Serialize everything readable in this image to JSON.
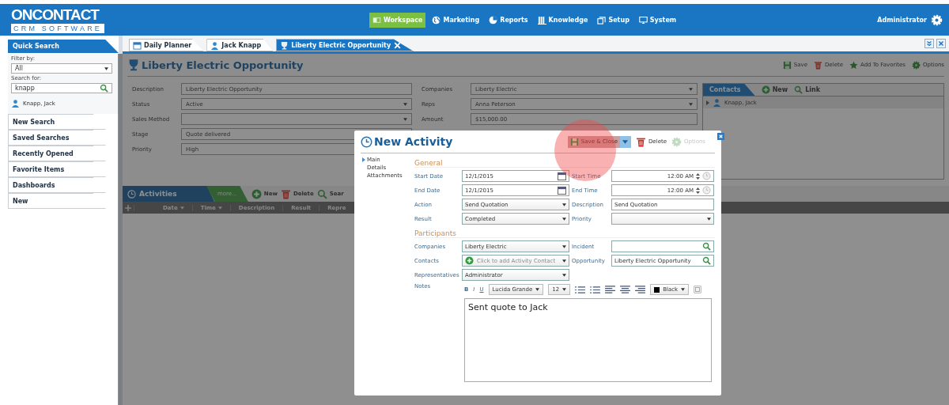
{
  "header": {
    "logo": "ONCONTACT",
    "logo_sub": "CRM SOFTWARE",
    "user": "Administrator",
    "nav": [
      {
        "label": "Workspace",
        "selected": true
      },
      {
        "label": "Marketing",
        "selected": false
      },
      {
        "label": "Reports",
        "selected": false
      },
      {
        "label": "Knowledge",
        "selected": false
      },
      {
        "label": "Setup",
        "selected": false
      },
      {
        "label": "System",
        "selected": false
      }
    ]
  },
  "sidebar": {
    "title": "Quick Search",
    "filter_label": "Filter by:",
    "filter_value": "All",
    "search_label": "Search for:",
    "search_value": "knapp",
    "result": "Knapp, Jack",
    "sections": [
      "New Search",
      "Saved Searches",
      "Recently Opened",
      "Favorite Items",
      "Dashboards",
      "New"
    ]
  },
  "tabs": [
    {
      "label": "Daily Planner",
      "selected": false,
      "closable": false
    },
    {
      "label": "Jack Knapp",
      "selected": false,
      "closable": false
    },
    {
      "label": "Liberty Electric Opportunity",
      "selected": true,
      "closable": true
    }
  ],
  "record": {
    "title": "Liberty Electric Opportunity",
    "actions": [
      "Save",
      "Delete",
      "Add To Favorites",
      "Options"
    ],
    "left_fields": [
      {
        "label": "Description",
        "value": "Liberty Electric Opportunity",
        "kind": "text"
      },
      {
        "label": "Status",
        "value": "Active",
        "kind": "select"
      },
      {
        "label": "Sales Method",
        "kind": "select"
      },
      {
        "label": "Stage",
        "value": "Quote delivered",
        "kind": "select"
      },
      {
        "label": "Priority",
        "value": "High",
        "kind": "select"
      }
    ],
    "right_fields": [
      {
        "label": "Companies",
        "value": "Liberty Electric",
        "kind": "select"
      },
      {
        "label": "Reps",
        "value": "Anna Peterson",
        "kind": "select"
      },
      {
        "label": "Amount",
        "value": "$15,000.00",
        "kind": "text"
      }
    ],
    "contacts": {
      "title": "Contacts",
      "actions": [
        "New",
        "Link"
      ],
      "rows": [
        "Knapp, Jack"
      ]
    }
  },
  "activities": {
    "title": "Activities",
    "more": "more...",
    "actions": [
      "New",
      "Delete",
      "Sear"
    ],
    "columns": [
      {
        "label": "Date",
        "sortable": true
      },
      {
        "label": "Time",
        "sortable": true
      },
      {
        "label": "Description",
        "sortable": false
      },
      {
        "label": "Result",
        "sortable": false
      },
      {
        "label": "Repre",
        "sortable": false
      }
    ]
  },
  "dialog": {
    "title": "New Activity",
    "save_close": "Save & Close",
    "delete": "Delete",
    "options": {
      "label": "Options",
      "disabled": true
    },
    "nav": [
      {
        "label": "Main",
        "selected": true
      },
      {
        "label": "Details",
        "selected": false
      },
      {
        "label": "Attachments",
        "selected": false
      }
    ],
    "sections": [
      {
        "title": "General",
        "rows": [
          [
            {
              "label": "Start Date",
              "value": "12/1/2015",
              "kind": "date"
            },
            {
              "label": "Start Time",
              "value": "12:00 AM",
              "kind": "time"
            }
          ],
          [
            {
              "label": "End Date",
              "value": "12/1/2015",
              "kind": "date"
            },
            {
              "label": "End Time",
              "value": "12:00 AM",
              "kind": "time"
            }
          ],
          [
            {
              "label": "Action",
              "value": "Send Quotation",
              "kind": "select"
            },
            {
              "label": "Description",
              "value": "Send Quotation",
              "kind": "text"
            }
          ],
          [
            {
              "label": "Result",
              "value": "Completed",
              "kind": "select"
            },
            {
              "label": "Priority",
              "kind": "select"
            }
          ]
        ]
      },
      {
        "title": "Participants",
        "rows": [
          [
            {
              "label": "Companies",
              "value": "Liberty Electric",
              "kind": "select"
            },
            {
              "label": "Incident",
              "kind": "lookup"
            }
          ],
          [
            {
              "label": "Contacts",
              "placeholder": "Click to add Activity Contact",
              "kind": "add"
            },
            {
              "label": "Opportunity",
              "value": "Liberty Electric Opportunity",
              "kind": "lookup"
            }
          ],
          [
            {
              "label": "Representatives",
              "value": "Administrator",
              "kind": "select"
            }
          ]
        ]
      }
    ],
    "notes": {
      "label": "Notes",
      "bold": "B",
      "italic": "I",
      "underline": "U",
      "font": "Lucida Grande",
      "size": "12",
      "ink": "Black",
      "text": "Sent quote to Jack"
    }
  }
}
